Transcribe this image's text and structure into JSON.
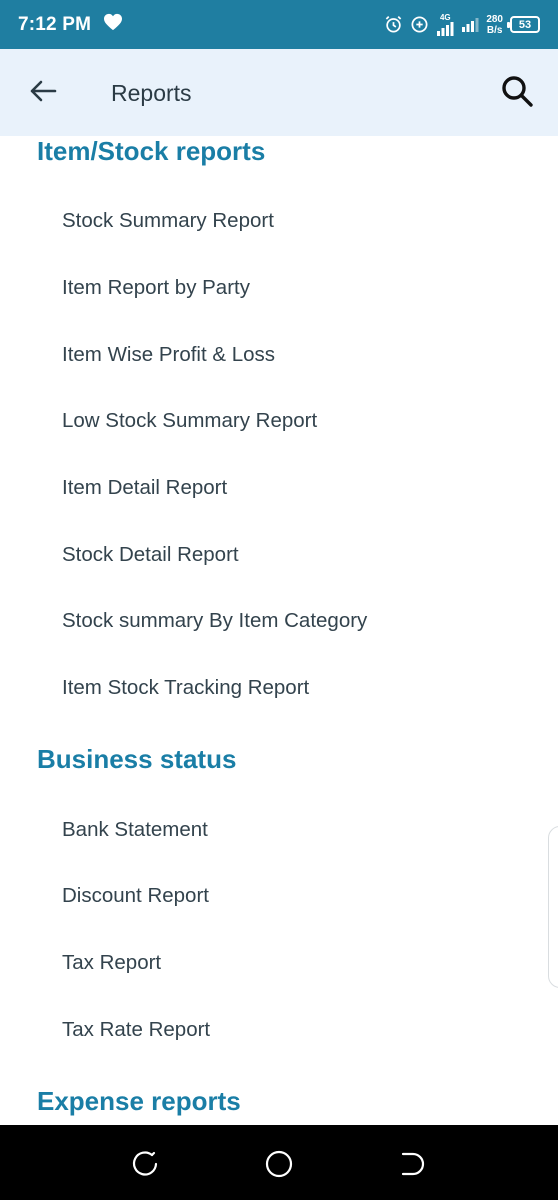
{
  "status_bar": {
    "time": "7:12 PM",
    "network_type": "4G",
    "net_speed_value": "280",
    "net_speed_unit": "B/s",
    "battery_level": "53"
  },
  "toolbar": {
    "title": "Reports"
  },
  "sections": [
    {
      "title": "Item/Stock reports",
      "items": [
        "Stock Summary Report",
        "Item Report by Party",
        "Item Wise Profit & Loss",
        "Low Stock Summary Report",
        "Item Detail Report",
        "Stock Detail Report",
        "Stock summary By Item Category",
        "Item Stock Tracking Report"
      ]
    },
    {
      "title": "Business status",
      "items": [
        "Bank Statement",
        "Discount Report",
        "Tax Report",
        "Tax Rate Report"
      ]
    },
    {
      "title": "Expense reports",
      "items": []
    }
  ],
  "colors": {
    "status_bar": "#1f7ea1",
    "toolbar_bg": "#e9f2fb",
    "section_title": "#1a7ea6",
    "item_text": "#33434d"
  },
  "icons": {
    "back": "arrow-left-icon",
    "search": "search-icon",
    "heart": "heart-icon",
    "alarm": "alarm-icon",
    "data_saver": "data-saver-icon",
    "signal": "signal-icon"
  }
}
